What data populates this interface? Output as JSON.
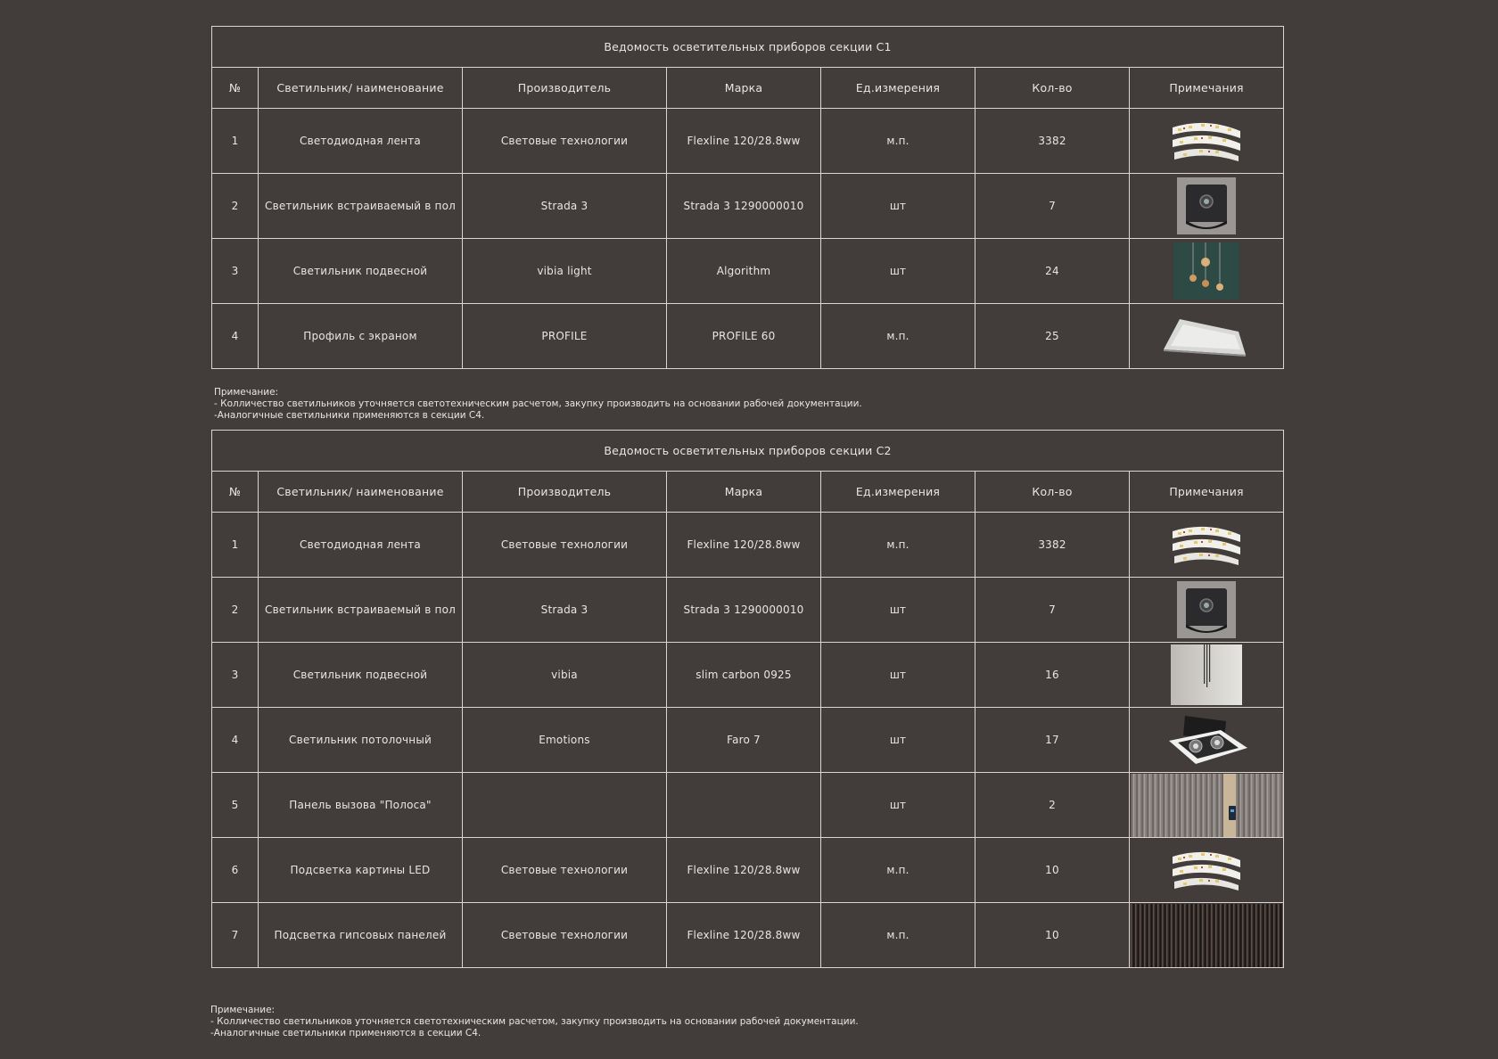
{
  "table1": {
    "title": "Ведомость осветительных приборов секции С1",
    "headers": [
      "№",
      "Светильник/ наименование",
      "Производитель",
      "Марка",
      "Ед.измерения",
      "Кол-во",
      "Примечания"
    ],
    "rows": [
      {
        "num": "1",
        "name": "Светодиодная лента",
        "maker": "Световые технологии",
        "model": "Flexline 120/28.8ww",
        "unit": "м.п.",
        "qty": "3382",
        "icon": "led-strip-icon"
      },
      {
        "num": "2",
        "name": "Светильник встраиваемый в пол",
        "maker": "Strada 3",
        "model": "Strada 3 1290000010",
        "unit": "шт",
        "qty": "7",
        "icon": "floor-spot-icon"
      },
      {
        "num": "3",
        "name": "Светильник подвесной",
        "maker": "vibia light",
        "model": "Algorithm",
        "unit": "шт",
        "qty": "24",
        "icon": "pendant-lamp-icon"
      },
      {
        "num": "4",
        "name": "Профиль с экраном",
        "maker": "PROFILE",
        "model": "PROFILE 60",
        "unit": "м.п.",
        "qty": "25",
        "icon": "profile-icon"
      }
    ]
  },
  "note1": {
    "label": "Примечание:",
    "line1": "- Колличество  светильников уточняется светотехническим  расчетом, закупку производить на основании рабочей документации.",
    "line2": "-Аналогичные светильники применяются в секции С4."
  },
  "table2": {
    "title": "Ведомость осветительных приборов секции С2",
    "headers": [
      "№",
      "Светильник/ наименование",
      "Производитель",
      "Марка",
      "Ед.измерения",
      "Кол-во",
      "Примечания"
    ],
    "rows": [
      {
        "num": "1",
        "name": "Светодиодная лента",
        "maker": "Световые технологии",
        "model": "Flexline 120/28.8ww",
        "unit": "м.п.",
        "qty": "3382",
        "icon": "led-strip-icon"
      },
      {
        "num": "2",
        "name": "Светильник встраиваемый в пол",
        "maker": "Strada 3",
        "model": "Strada 3 1290000010",
        "unit": "шт",
        "qty": "7",
        "icon": "floor-spot-icon"
      },
      {
        "num": "3",
        "name": "Светильник подвесной",
        "maker": "vibia",
        "model": "slim carbon 0925",
        "unit": "шт",
        "qty": "16",
        "icon": "slim-pendant-icon"
      },
      {
        "num": "4",
        "name": "Светильник потолочный",
        "maker": "Emotions",
        "model": "Faro 7",
        "unit": "шт",
        "qty": "17",
        "icon": "ceiling-spot-icon"
      },
      {
        "num": "5",
        "name": "Панель вызова \"Полоса\"",
        "maker": "",
        "model": "",
        "unit": "шт",
        "qty": "2",
        "icon": "call-panel-icon"
      },
      {
        "num": "6",
        "name": "Подсветка картины LED",
        "maker": "Световые технологии",
        "model": "Flexline 120/28.8ww",
        "unit": "м.п.",
        "qty": "10",
        "icon": "led-strip-icon"
      },
      {
        "num": "7",
        "name": "Подсветка гипсовых панелей",
        "maker": "Световые технологии",
        "model": "Flexline 120/28.8ww",
        "unit": "м.п.",
        "qty": "10",
        "icon": "gypsum-panel-icon"
      }
    ]
  },
  "note2": {
    "label": "Примечание:",
    "line1": "- Колличество  светильников уточняется светотехническим  расчетом, закупку производить на основании рабочей документации.",
    "line2": "-Аналогичные светильники применяются в секции С4."
  }
}
